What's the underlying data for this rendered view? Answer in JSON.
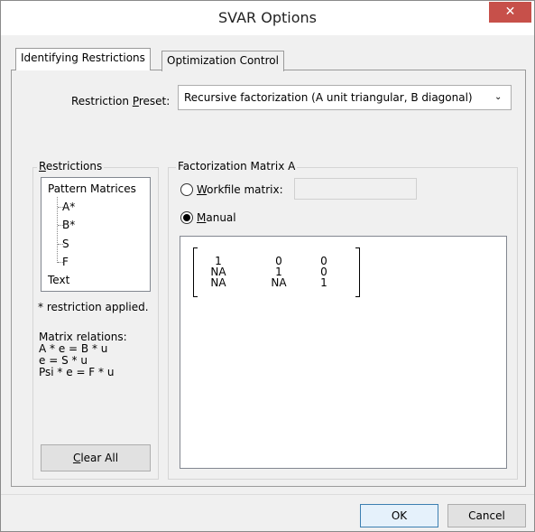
{
  "window": {
    "title": "SVAR Options",
    "close_glyph": "✕"
  },
  "tabs": [
    {
      "label": "Identifying Restrictions",
      "active": true
    },
    {
      "label": "Optimization Control",
      "active": false
    }
  ],
  "preset": {
    "label_before": "Restriction ",
    "label_mnemonic": "P",
    "label_after": "reset:",
    "value": "Recursive factorization (A unit triangular, B diagonal)",
    "arrow_glyph": "⌄"
  },
  "restrictions": {
    "title_mnemonic": "R",
    "title_rest": "estrictions",
    "tree": {
      "root1": "Pattern Matrices",
      "children": [
        "A*",
        "B*",
        "S",
        "F"
      ],
      "root2": "Text"
    },
    "note": "* restriction applied.",
    "relations": {
      "heading": "Matrix relations:",
      "lines": [
        "A * e = B * u",
        "e = S * u",
        "Psi * e = F * u"
      ]
    },
    "clear_before": "",
    "clear_mnemonic": "C",
    "clear_after": "lear All"
  },
  "factorization": {
    "title": "Factorization Matrix A",
    "workfile": {
      "mnemonic": "W",
      "rest": "orkfile matrix:",
      "value": ""
    },
    "manual": {
      "mnemonic": "M",
      "rest": "anual",
      "selected": true
    },
    "matrix": [
      [
        "1",
        "0",
        "0"
      ],
      [
        "NA",
        "1",
        "0"
      ],
      [
        "NA",
        "NA",
        "1"
      ]
    ]
  },
  "footer": {
    "ok_label": "OK",
    "cancel_label": "Cancel"
  },
  "colors": {
    "close_button": "#c7504a",
    "ok_border": "#3c7fb1"
  }
}
